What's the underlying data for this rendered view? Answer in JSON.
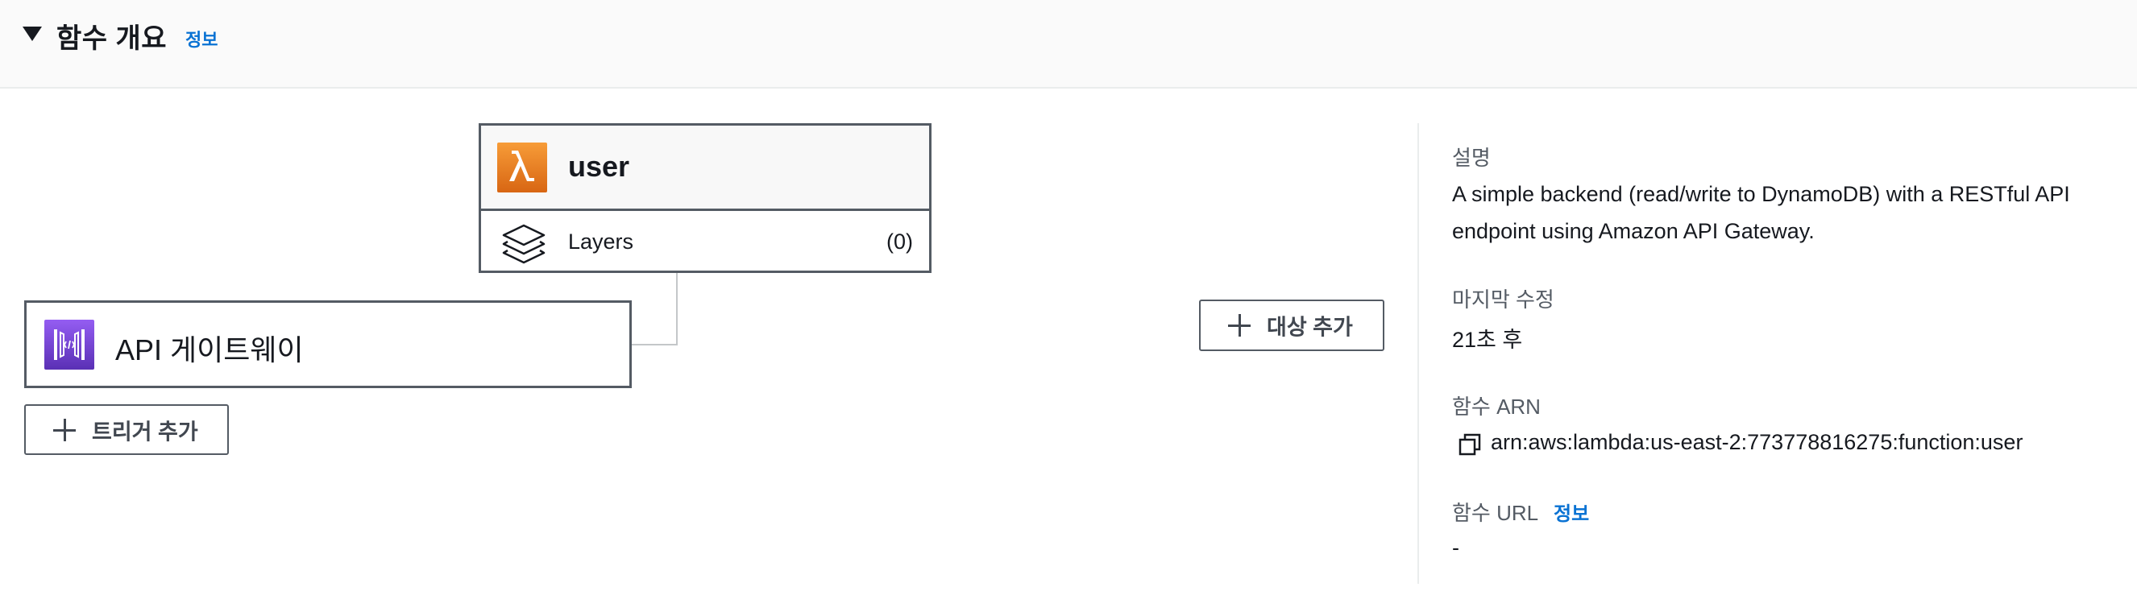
{
  "header": {
    "title": "함수 개요",
    "info_link": "정보"
  },
  "function": {
    "name": "user",
    "layers_label": "Layers",
    "layers_count": "(0)"
  },
  "trigger": {
    "name": "API 게이트웨이",
    "add_trigger_label": "트리거 추가"
  },
  "destination": {
    "add_destination_label": "대상 추가"
  },
  "details": {
    "description_label": "설명",
    "description_value": "A simple backend (read/write to DynamoDB) with a RESTful API endpoint using Amazon API Gateway.",
    "last_modified_label": "마지막 수정",
    "last_modified_value": "21초 후",
    "arn_label": "함수 ARN",
    "arn_value": "arn:aws:lambda:us-east-2:773778816275:function:user",
    "url_label": "함수 URL",
    "url_info_link": "정보",
    "url_value": "-"
  },
  "colors": {
    "lambda": "#d86613",
    "api_gateway": "#7a3fe0",
    "link": "#0972d3",
    "border": "#545b64"
  },
  "icons": {
    "collapse": "caret-down-icon",
    "lambda": "lambda-icon",
    "layers": "layers-icon",
    "gateway": "api-gateway-icon",
    "add": "plus-icon",
    "copy": "copy-icon"
  }
}
